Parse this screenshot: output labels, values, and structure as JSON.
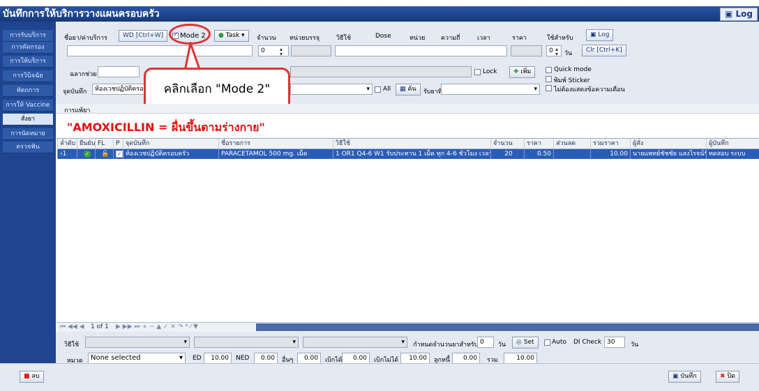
{
  "window": {
    "title": "บันทึกการให้บริการวางแผนครอบครัว",
    "log_label": "Log"
  },
  "sidebar": {
    "items": [
      {
        "label": "การรับบริการ"
      },
      {
        "label": "การคัดกรอง"
      },
      {
        "label": "การให้บริการ"
      },
      {
        "label": "การวินิจฉัย"
      },
      {
        "label": "หัตถการ"
      },
      {
        "label": "การให้ Vaccine"
      },
      {
        "label": "สั่งยา"
      },
      {
        "label": "การนัดหมาย"
      },
      {
        "label": "ตรวจฟัน"
      }
    ]
  },
  "form": {
    "drug_label": "ชื่อยา/ค่าบริการ",
    "wd_button": "WD [Ctrl+W]",
    "mode2_label": "Mode 2",
    "task_button": "Task",
    "qty_header": "จำนวน",
    "unit_header": "หน่วยบรรจุ",
    "usage_header": "วิธีใช้",
    "dose_header": "Dose",
    "dose_unit_header": "หน่วย",
    "freq_header": "ความถี่",
    "time_header": "เวลา",
    "price_header": "ราคา",
    "for_header": "ใช้สำหรับ",
    "log_button": "Log",
    "qty_value": "0",
    "days_value": "0",
    "days_unit": "วัน",
    "clr_button": "Clr [Ctrl+K]",
    "label_text": "ฉลากช่วย",
    "lock_label": "Lock",
    "add_button": "เพิ่ม",
    "quick_mode": "Quick mode",
    "print_sticker": "พิมพ์ Sticker",
    "no_warn": "ไม่ต้องแสดงข้อความเตือน",
    "point_label": "จุดบันทึก",
    "point_value": "ห้องเวชปฏิบัติครอ",
    "all_label": "All",
    "search_button": "ค้น",
    "receive_label": "รับยาที่"
  },
  "callout": {
    "text": "คลิกเลือก \"Mode 2\""
  },
  "tab_label": "การแพ้ยา",
  "warning": "\"AMOXICILLIN = ผื่นขึ้นตามร่างกาย\"",
  "grid": {
    "headers": [
      "ลำดับ",
      "ยืนยัน",
      "FL",
      "P",
      "จุดบันทึก",
      "ชื่อรายการ",
      "วิธีใช้",
      "จำนวน",
      "ราคา",
      "ส่วนลด",
      "รวมราคา",
      "ผู้สั่ง",
      "ผู้บันทึก"
    ],
    "rows": [
      {
        "no": "1",
        "point": "ห้องเวชปฏิบัติครอบครัว",
        "name": "PARACETAMOL 500 mg. เม็ด",
        "usage": "1 OR1 Q4-6 W1 รับประทาน 1 เม็ด ทุก 4-6 ชั่วโมง เวลาปวด",
        "qty": "20",
        "price": "0.50",
        "discount": "",
        "total": "10.00",
        "orderer": "นายแพทย์ชัชชัย แสงไรจน์รั",
        "recorder": "ทดสอบ ระบบ"
      }
    ],
    "nav": "1 of 1"
  },
  "bottom": {
    "usage_label": "วิธีใช้",
    "limit_label": "กำหนดจำนวนยาสำหรับ",
    "limit_value": "0",
    "limit_unit": "วัน",
    "set_button": "Set",
    "auto_label": "Auto",
    "di_check_label": "DI Check",
    "di_check_value": "30",
    "di_unit": "วัน",
    "category_label": "หมวด",
    "category_value": "None selected",
    "ed_label": "ED",
    "ed_value": "10.00",
    "ned_label": "NED",
    "ned_value": "0.00",
    "other_label": "อื่นๆ",
    "other_value": "0.00",
    "claimable_label": "เบิกได้",
    "claimable_value": "0.00",
    "nonclaim_label": "เบิกไม่ได้",
    "nonclaim_value": "10.00",
    "debtor_label": "ลูกหนี้",
    "debtor_value": "0.00",
    "sum_label": "รวม",
    "sum_value": "10.00"
  },
  "footer": {
    "delete_button": "ลบ",
    "save_button": "บันทึก",
    "close_button": "ปิด"
  },
  "colors": {
    "accent": "#1f4590",
    "selected_row": "#2a5db8",
    "warning": "#e01010",
    "callout": "#dd3333"
  }
}
